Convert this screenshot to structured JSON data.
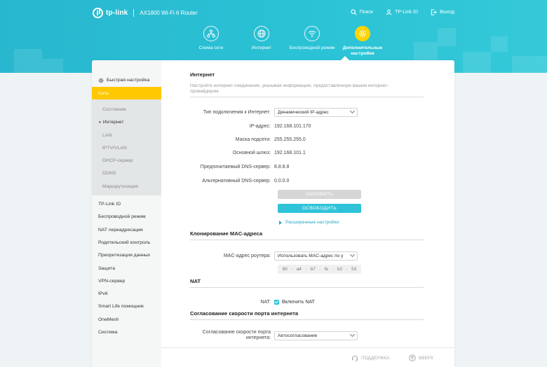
{
  "header": {
    "brand": "tp-link",
    "model": "AX1800 Wi-Fi 6 Router",
    "links": [
      {
        "label": "Поиск",
        "icon": "search-icon"
      },
      {
        "label": "TP-Link ID",
        "icon": "user-icon"
      },
      {
        "label": "Выход",
        "icon": "logout-icon"
      }
    ],
    "nav": [
      {
        "label": "Схема сети",
        "icon": "network-map-icon"
      },
      {
        "label": "Интернет",
        "icon": "globe-icon"
      },
      {
        "label": "Беспроводной режим",
        "icon": "wifi-icon"
      },
      {
        "label": "Дополнительные настройки",
        "icon": "gear-icon"
      }
    ]
  },
  "sidebar": {
    "quick_setup": "Быстрая настройка",
    "network": "Сеть",
    "network_children": [
      "Состояние",
      "Интернет",
      "LAN",
      "IPTV/VLAN",
      "DHCP-сервер",
      "DDNS",
      "Маршрутизация"
    ],
    "items": [
      "TP-Link ID",
      "Беспроводной режим",
      "NAT переадресация",
      "Родительский контроль",
      "Приоритезация данных",
      "Защита",
      "VPN-сервер",
      "IPv6",
      "Smart Life помощник",
      "OneMesh",
      "Система"
    ]
  },
  "internet": {
    "title": "Интернет",
    "description": "Настройте интернет-соединение, указывая информацию, предоставленную вашим интернет-провайдером.",
    "connection_type_label": "Тип подключения к Интернет:",
    "connection_type_value": "Динамический IP-адрес",
    "ip_label": "IP-адрес:",
    "ip_value": "192.168.101.170",
    "mask_label": "Маска подсети:",
    "mask_value": "255.255.255.0",
    "gateway_label": "Основной шлюз:",
    "gateway_value": "192.168.101.1",
    "dns1_label": "Предпочитаемый DNS-сервер:",
    "dns1_value": "8.8.8.8",
    "dns2_label": "Альтернативный DNS-сервер:",
    "dns2_value": "0.0.0.0",
    "renew_button": "ОБНОВИТЬ",
    "release_button": "ОСВОБОДИТЬ",
    "advanced_link": "Расширенные настройки"
  },
  "mac_clone": {
    "title": "Клонирование MAC-адреса",
    "router_mac_label": "MAC-адрес роутера:",
    "router_mac_value": "Использовать MAC-адрес по у",
    "mac_octets": [
      "60",
      "a4",
      "b7",
      "fe",
      "b2",
      "53"
    ]
  },
  "nat": {
    "title": "NAT",
    "label": "NAT:",
    "checkbox_label": "Включить NAT"
  },
  "port_speed": {
    "title": "Согласование скорости порта интернета",
    "label_line1": "Согласование скорости порта",
    "label_line2": "интернета:",
    "value": "Автосогласование"
  },
  "footer": {
    "support": "ПОДДЕРЖКА",
    "top": "ВВЕРХ"
  },
  "colors": {
    "header_bg": "#2bc3d6",
    "accent_yellow": "#ffc800",
    "button_primary": "#2fc3d9",
    "link": "#2aa7c7"
  }
}
